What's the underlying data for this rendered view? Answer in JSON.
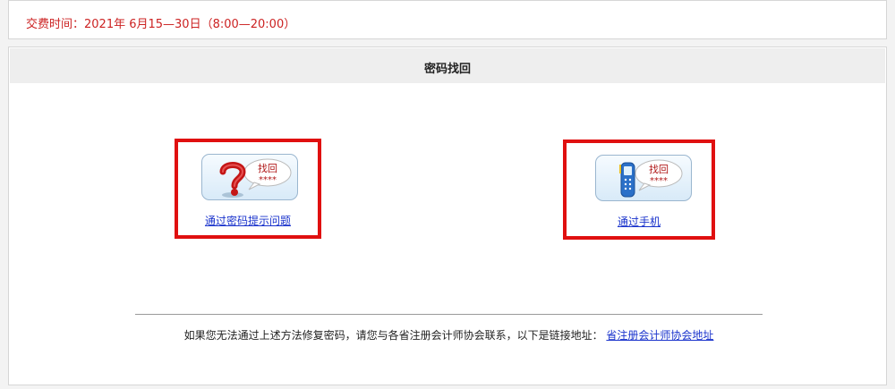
{
  "notice": {
    "text": "交费时间：2021年 6月15—30日（8:00—20:00）",
    "color": "#cc2222"
  },
  "panel": {
    "title": "密码找回"
  },
  "options": [
    {
      "icon": "question-mark-icon",
      "bubble_line1": "找回",
      "bubble_line2": "****",
      "link": "通过密码提示问题"
    },
    {
      "icon": "mobile-phone-icon",
      "bubble_line1": "找回",
      "bubble_line2": "****",
      "link": "通过手机"
    }
  ],
  "footer": {
    "text": "如果您无法通过上述方法修复密码，请您与各省注册会计师协会联系，以下是链接地址：",
    "link": "省注册会计师协会地址"
  },
  "colors": {
    "highlight_border": "#e01010",
    "link": "#1a33cc"
  }
}
